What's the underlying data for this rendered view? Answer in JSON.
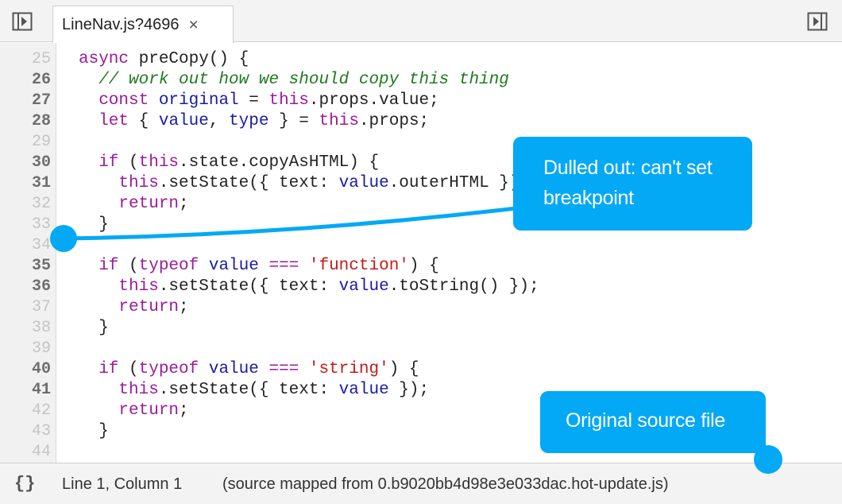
{
  "tab": {
    "label": "LineNav.js?4696",
    "close_glyph": "×"
  },
  "icons": {
    "left_panel": "toggle-navigator-icon",
    "right_panel": "toggle-debugger-icon",
    "close": "close-icon",
    "pretty_print": "pretty-print-icon"
  },
  "gutter": {
    "lines": [
      {
        "num": "25",
        "enabled": false
      },
      {
        "num": "26",
        "enabled": true
      },
      {
        "num": "27",
        "enabled": true
      },
      {
        "num": "28",
        "enabled": true
      },
      {
        "num": "29",
        "enabled": false
      },
      {
        "num": "30",
        "enabled": true
      },
      {
        "num": "31",
        "enabled": true
      },
      {
        "num": "32",
        "enabled": false
      },
      {
        "num": "33",
        "enabled": false
      },
      {
        "num": "34",
        "enabled": false
      },
      {
        "num": "35",
        "enabled": true
      },
      {
        "num": "36",
        "enabled": true
      },
      {
        "num": "37",
        "enabled": false
      },
      {
        "num": "38",
        "enabled": false
      },
      {
        "num": "39",
        "enabled": false
      },
      {
        "num": "40",
        "enabled": true
      },
      {
        "num": "41",
        "enabled": true
      },
      {
        "num": "42",
        "enabled": false
      },
      {
        "num": "43",
        "enabled": false
      },
      {
        "num": "44",
        "enabled": false
      }
    ]
  },
  "code": [
    [
      [
        "kw",
        "async"
      ],
      [
        "pl",
        " preCopy() {"
      ]
    ],
    [
      [
        "com",
        "  // work out how we should copy this thing"
      ]
    ],
    [
      [
        "kw",
        "  const "
      ],
      [
        "var",
        "original"
      ],
      [
        "pl",
        " = "
      ],
      [
        "kw",
        "this"
      ],
      [
        "pl",
        ".props.value;"
      ]
    ],
    [
      [
        "kw",
        "  let "
      ],
      [
        "pl",
        "{ "
      ],
      [
        "var",
        "value"
      ],
      [
        "pl",
        ", "
      ],
      [
        "var",
        "type"
      ],
      [
        "pl",
        " } = "
      ],
      [
        "kw",
        "this"
      ],
      [
        "pl",
        ".props;"
      ]
    ],
    [],
    [
      [
        "kw",
        "  if "
      ],
      [
        "pl",
        "("
      ],
      [
        "kw",
        "this"
      ],
      [
        "pl",
        ".state.copyAsHTML) {"
      ]
    ],
    [
      [
        "kw",
        "    this"
      ],
      [
        "pl",
        ".setState({ text: "
      ],
      [
        "var",
        "value"
      ],
      [
        "pl",
        ".outerHTML });"
      ]
    ],
    [
      [
        "kw",
        "    return"
      ],
      [
        "pl",
        ";"
      ]
    ],
    [
      [
        "pl",
        "  }"
      ]
    ],
    [],
    [
      [
        "kw",
        "  if "
      ],
      [
        "pl",
        "("
      ],
      [
        "kw",
        "typeof "
      ],
      [
        "var",
        "value"
      ],
      [
        "kw",
        " === "
      ],
      [
        "str",
        "'function'"
      ],
      [
        "pl",
        ") {"
      ]
    ],
    [
      [
        "kw",
        "    this"
      ],
      [
        "pl",
        ".setState({ text: "
      ],
      [
        "var",
        "value"
      ],
      [
        "pl",
        ".toString() });"
      ]
    ],
    [
      [
        "kw",
        "    return"
      ],
      [
        "pl",
        ";"
      ]
    ],
    [
      [
        "pl",
        "  }"
      ]
    ],
    [],
    [
      [
        "kw",
        "  if "
      ],
      [
        "pl",
        "("
      ],
      [
        "kw",
        "typeof "
      ],
      [
        "var",
        "value"
      ],
      [
        "kw",
        " === "
      ],
      [
        "str",
        "'string'"
      ],
      [
        "pl",
        ") {"
      ]
    ],
    [
      [
        "kw",
        "    this"
      ],
      [
        "pl",
        ".setState({ text: "
      ],
      [
        "var",
        "value"
      ],
      [
        "pl",
        " });"
      ]
    ],
    [
      [
        "kw",
        "    return"
      ],
      [
        "pl",
        ";"
      ]
    ],
    [
      [
        "pl",
        "  }"
      ]
    ],
    []
  ],
  "status": {
    "braces": "{}",
    "position": "Line 1, Column 1",
    "mapping": "(source mapped from 0.b9020bb4d98e3e033dac.hot-update.js)"
  },
  "annotations": {
    "dulled_line1": "Dulled out: can't set",
    "dulled_line2": "breakpoint",
    "original": "Original source file"
  },
  "colors": {
    "accent": "#03a9f4",
    "keyword": "#9b1b9b",
    "variable": "#1a1aa6",
    "string": "#c41a16",
    "comment": "#1f7a1f",
    "line_number_enabled": "#6e6e6e",
    "line_number_disabled": "#c4c4c4"
  }
}
